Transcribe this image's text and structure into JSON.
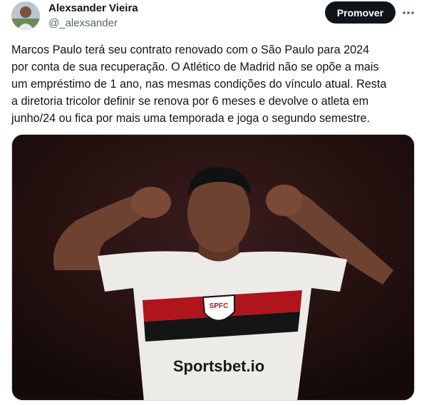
{
  "author": {
    "name": "Alexsander Vieira",
    "handle": "@_alexsander",
    "avatar_icon": "profile-avatar"
  },
  "actions": {
    "promote_label": "Promover",
    "more_icon": "more-horizontal-icon"
  },
  "tweet": {
    "text": "Marcos Paulo terá seu contrato renovado com o São Paulo para 2024\npor conta de sua recuperação. O Atlético de Madrid não se opõe a mais\num empréstimo de 1 ano, nas mesmas condições do vínculo atual. Resta\na diretoria tricolor definir se renova por 6 meses e devolve o atleta em\njunho/24 ou fica por mais uma temporada e joga o segundo semestre."
  },
  "media": {
    "badge_text": "SPFC",
    "sponsor_text": "Sportsbet.io",
    "colors": {
      "background": "#1e1012",
      "shirt": "#ecebe8",
      "stripe_red": "#b0141c",
      "stripe_black": "#151515",
      "skin": "#6e4231"
    }
  }
}
